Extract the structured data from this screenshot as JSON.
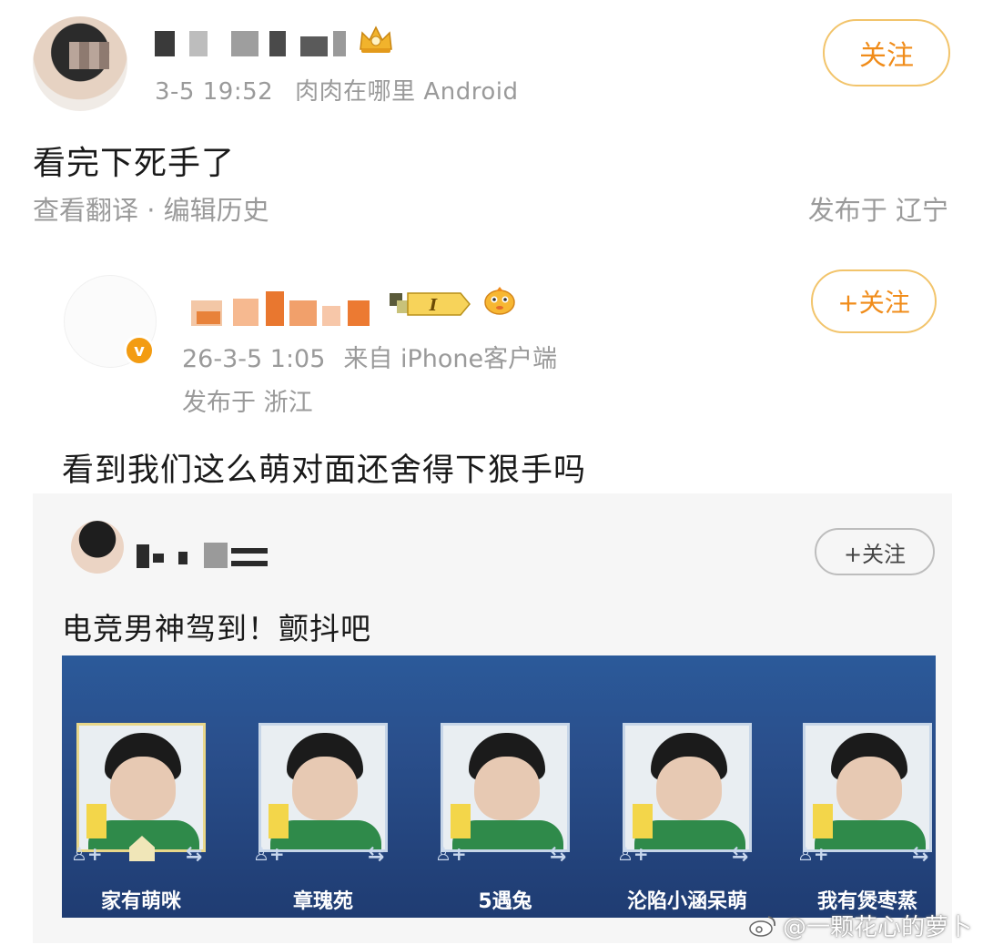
{
  "post": {
    "time": "3-5 19:52",
    "source": "肉肉在哪里 Android",
    "follow_label": "关注",
    "text": "看完下死手了",
    "actions": "查看翻译 · 编辑历史",
    "location": "发布于 辽宁"
  },
  "quote": {
    "badge": "v",
    "level": "I",
    "time": "26-3-5 1:05",
    "source": "来自 iPhone客户端",
    "location": "发布于 浙江",
    "follow_label": "+关注",
    "text": "看到我们这么萌对面还舍得下狠手吗"
  },
  "card": {
    "follow_label": "+关注",
    "text": "电竞男神驾到！颤抖吧",
    "players": [
      {
        "name": "家有萌咪"
      },
      {
        "name": "章瑰苑"
      },
      {
        "name": "5遇兔"
      },
      {
        "name": "沦陷小涵呆萌"
      },
      {
        "name": "我有煲枣蒸"
      }
    ]
  },
  "watermark": "@一颗花心的萝卜",
  "colors": {
    "accent_orange": "#f08c1a",
    "follow_border": "#f2c46b",
    "meta_gray": "#9a9a9a",
    "game_blue": "#2a4f8c"
  },
  "icons": [
    "crown-icon",
    "vip-badge-icon",
    "level-badge-icon",
    "fish-icon",
    "home-icon",
    "add-friend-icon",
    "swap-icon",
    "weibo-icon"
  ]
}
